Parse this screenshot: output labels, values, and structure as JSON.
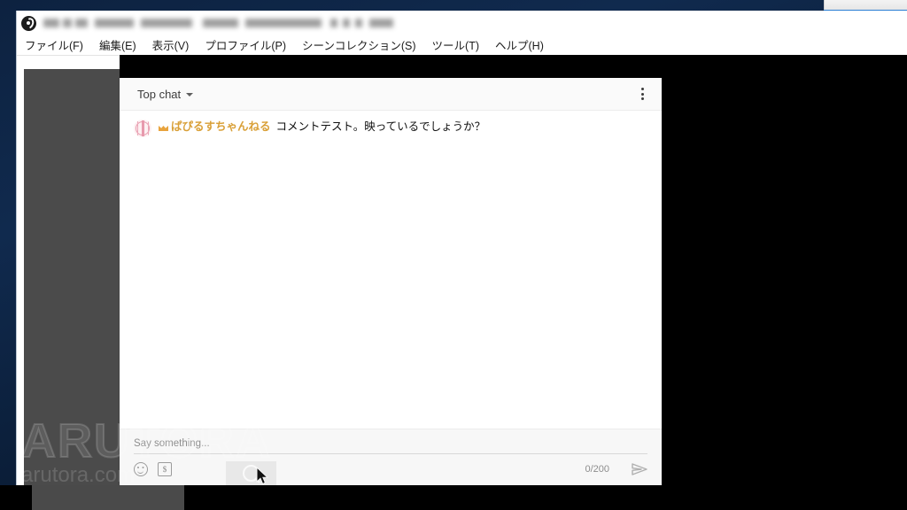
{
  "desktop": {
    "background_color": "#0d2240"
  },
  "obs_window": {
    "app_icon": "obs-logo-icon",
    "title": "(blurred)",
    "menu": [
      {
        "label": "ファイル(F)"
      },
      {
        "label": "編集(E)"
      },
      {
        "label": "表示(V)"
      },
      {
        "label": "プロファイル(P)"
      },
      {
        "label": "シーンコレクション(S)"
      },
      {
        "label": "ツール(T)"
      },
      {
        "label": "ヘルプ(H)"
      }
    ],
    "preview_background": "#4b4b4b"
  },
  "chat_dock": {
    "header": {
      "mode_label": "Top chat",
      "mode_caret_icon": "chevron-down-icon",
      "overflow_icon": "more-vertical-icon"
    },
    "messages": [
      {
        "avatar_icon": "user-avatar",
        "badge_icon": "crown-badge-icon",
        "author": "ぱぴるすちゃんねる",
        "author_color": "#d9a038",
        "text": "コメントテスト。映っているでしょうか？"
      }
    ],
    "composer": {
      "placeholder": "Say something...",
      "emoji_icon": "emoji-icon",
      "superchat_icon": "money-icon",
      "superchat_glyph": "$",
      "counter": "0/200",
      "send_icon": "send-arrow-icon"
    }
  },
  "watermark": {
    "big": "ARUTORA",
    "small": "arutora.com"
  },
  "taskbar": {
    "search_icon": "search-icon"
  }
}
